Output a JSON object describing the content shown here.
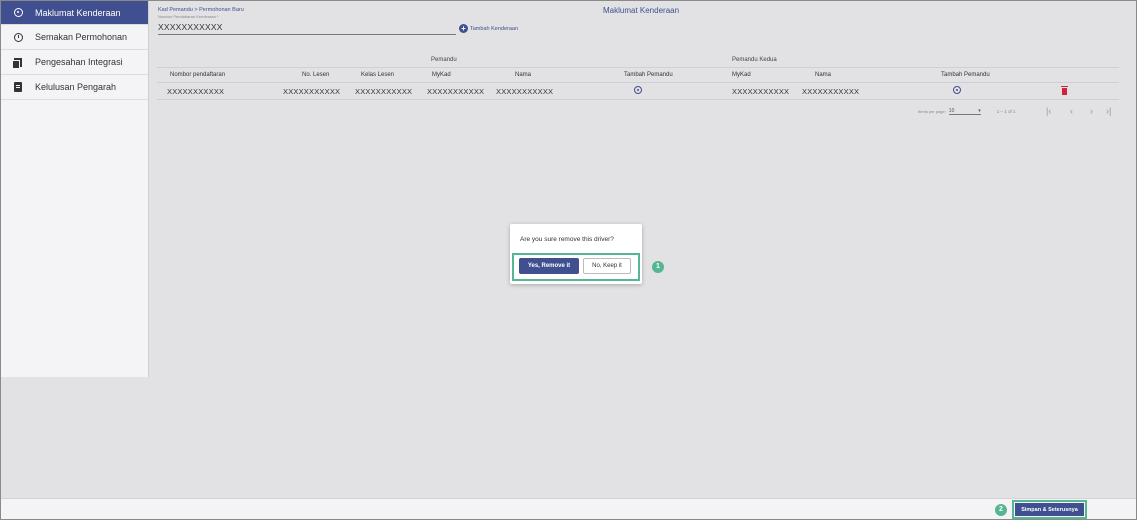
{
  "sidebar": {
    "items": [
      {
        "label": "Maklumat Kenderaan",
        "icon": "radio-circle-icon",
        "active": true
      },
      {
        "label": "Semakan Permohonan",
        "icon": "clock-icon"
      },
      {
        "label": "Pengesahan Integrasi",
        "icon": "documents-icon"
      },
      {
        "label": "Kelulusan Pengarah",
        "icon": "book-icon"
      }
    ]
  },
  "header": {
    "breadcrumb": "Kad Pemandu > Permohonan Baru",
    "field_label": "Nombor Pendaftaran Kenderaan *",
    "field_value": "XXXXXXXXXXX",
    "add_vehicle": "Tambah Kenderaan",
    "page_title": "Maklumat Kenderaan"
  },
  "table": {
    "group_headers": [
      "Pemandu",
      "Pemandu Kedua"
    ],
    "columns": [
      "Nombor pendaftaran",
      "No. Lesen",
      "Kelas Lesen",
      "MyKad",
      "Nama",
      "Tambah Pemandu",
      "MyKad",
      "Nama",
      "Tambah Pemandu"
    ],
    "rows": [
      {
        "no_pendaftaran": "XXXXXXXXXXX",
        "no_lesen": "XXXXXXXXXXX",
        "kelas_lesen": "XXXXXXXXXXX",
        "mykad": "XXXXXXXXXXX",
        "nama": "XXXXXXXXXXX",
        "mykad2": "XXXXXXXXXXX",
        "nama2": "XXXXXXXXXXX"
      }
    ]
  },
  "pagination": {
    "items_per_page_label": "Items per page:",
    "items_per_page": "10",
    "range": "1 – 1 of 1"
  },
  "dialog": {
    "message": "Are you sure remove this driver?",
    "yes_label": "Yes, Remove it",
    "no_label": "No, Keep it",
    "badge": "1"
  },
  "footer": {
    "save_label": "Simpan & Seterusnya",
    "badge": "2"
  },
  "colors": {
    "primary": "#3f4f8f",
    "highlight": "#55b691",
    "danger": "#d0213e",
    "overlay": "#e2e2e4"
  }
}
